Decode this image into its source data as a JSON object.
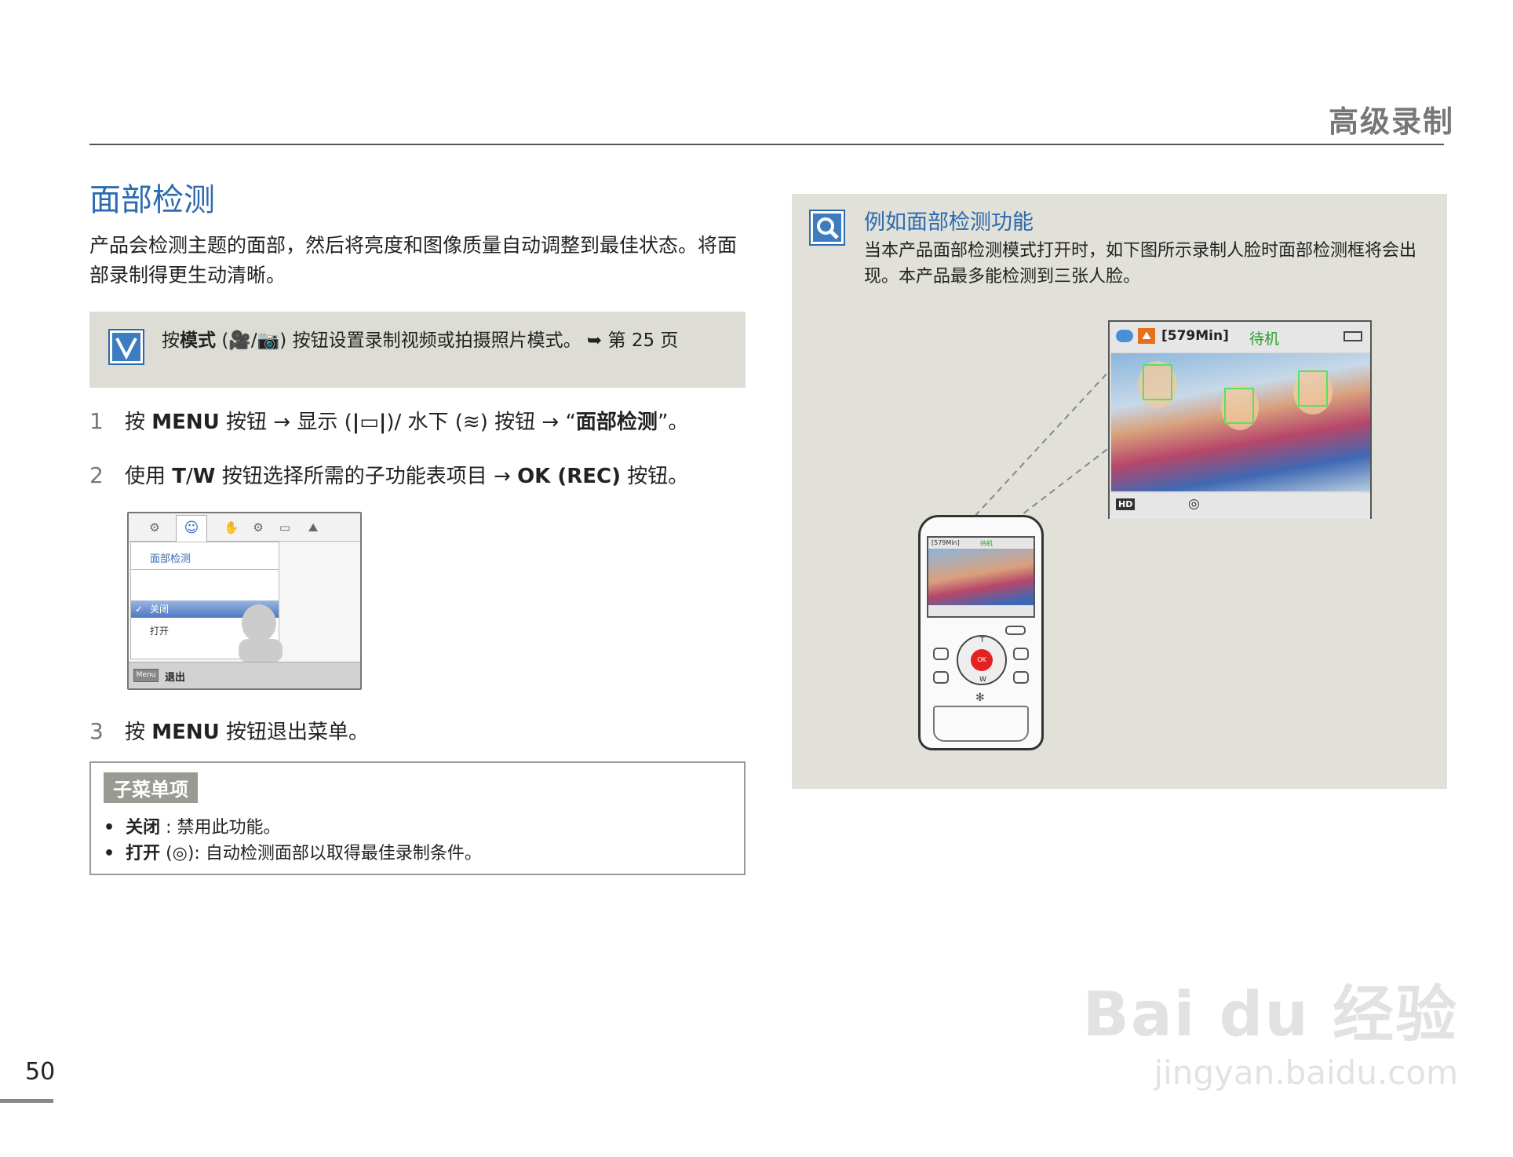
{
  "header": {
    "section": "高级录制"
  },
  "title": "面部检测",
  "intro": "产品会检测主题的面部，然后将亮度和图像质量自动调整到最佳状态。将面部录制得更生动清晰。",
  "note": {
    "prefix": "按",
    "mode_bold": "模式",
    "icons": "(🎥/📷)",
    "text": "按钮设置录制视频或拍摄照片模式。",
    "ref_arrow": "➥",
    "ref": "第 25 页"
  },
  "steps": [
    {
      "num": "1",
      "a": "按 ",
      "b1": "MENU",
      "c": " 按钮 → 显示 (",
      "d": "|▭|",
      "e": ")/ 水下 (",
      "f": "≋",
      "g": ") 按钮 → “",
      "b2": "面部检测",
      "h": "”。"
    },
    {
      "num": "2",
      "a": "使用 ",
      "b1": "T",
      "c": "/",
      "b2": "W",
      "d": " 按钮选择所需的子功能表项目 → ",
      "b3": "OK (REC)",
      "e": " 按钮。"
    },
    {
      "num": "3",
      "a": "按 ",
      "b1": "MENU",
      "c": " 按钮退出菜单。"
    }
  ],
  "menu_screen": {
    "title": "面部检测",
    "items": [
      "关闭",
      "打开"
    ],
    "selected": "关闭",
    "menu_label": "Menu",
    "exit": "退出"
  },
  "submenu": {
    "tag": "子菜单项",
    "items": [
      {
        "name": "关闭",
        "sep": " : ",
        "desc": "禁用此功能。"
      },
      {
        "name": "打开",
        "sep": " (◎): ",
        "desc": "自动检测面部以取得最佳录制条件。"
      }
    ]
  },
  "example": {
    "title": "例如面部检测功能",
    "body": "当本产品面部检测模式打开时，如下图所示录制人脸时面部检测框将会出现。本产品最多能检测到三张人脸。"
  },
  "lcd": {
    "time": "[579Min]",
    "status": "待机",
    "hd": "HD",
    "small_time": "[579Min]",
    "small_status": "待机"
  },
  "camera": {
    "ok": "OK",
    "t": "T",
    "w": "W"
  },
  "page_number": "50",
  "watermark": {
    "main": "Bai du 经验",
    "sub": "jingyan.baidu.com"
  },
  "colors": {
    "accent_blue": "#2b6bb0",
    "face_box": "#59e25a",
    "status_green": "#2aa02a"
  }
}
